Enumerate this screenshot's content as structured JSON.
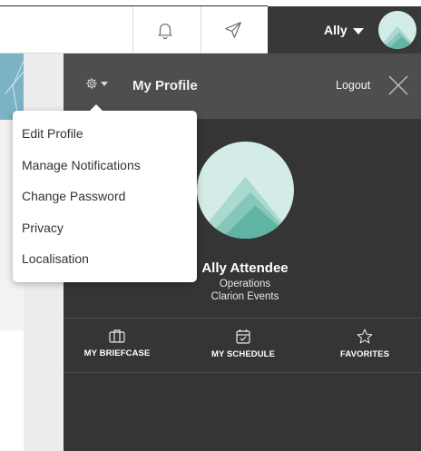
{
  "header": {
    "user_name": "Ally",
    "icons": {
      "notifications": "bell-icon",
      "messages": "paper-plane-icon"
    }
  },
  "panel": {
    "title": "My Profile",
    "logout_label": "Logout",
    "settings_icon": "gear-icon",
    "close_icon": "close-icon"
  },
  "settings_menu": {
    "items": [
      {
        "label": "Edit Profile"
      },
      {
        "label": "Manage Notifications"
      },
      {
        "label": "Change Password"
      },
      {
        "label": "Privacy"
      },
      {
        "label": "Localisation"
      }
    ]
  },
  "profile": {
    "name": "Ally Attendee",
    "department": "Operations",
    "company": "Clarion Events"
  },
  "quick_links": [
    {
      "label": "MY BRIEFCASE",
      "icon": "briefcase-icon"
    },
    {
      "label": "MY SCHEDULE",
      "icon": "calendar-icon"
    },
    {
      "label": "FAVORITES",
      "icon": "star-icon"
    }
  ],
  "colors": {
    "panel_bg": "#353535",
    "panel_header_bg": "#4e4e4e",
    "avatar_bg": "#d4ece7",
    "avatar_teal_light": "#a9d9cf",
    "avatar_teal_mid": "#86c7ba",
    "avatar_teal_dark": "#5fb4a3"
  }
}
